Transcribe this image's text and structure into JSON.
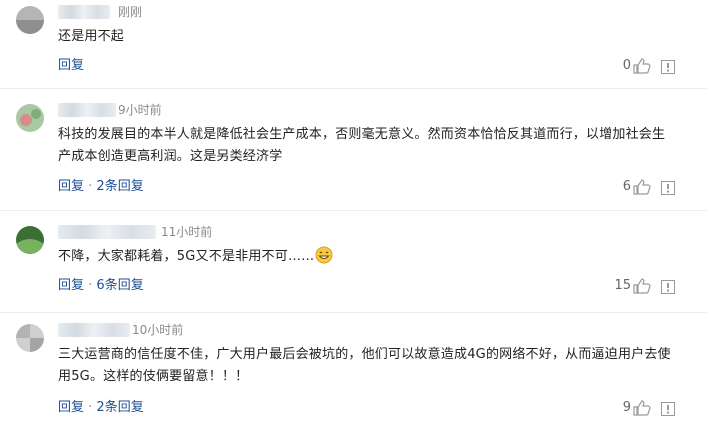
{
  "comments": [
    {
      "time": "刚刚",
      "text": "还是用不起",
      "reply": "回复",
      "more": "",
      "likes": "0",
      "avatar_colors": [
        "#b8b8b8",
        "#909090"
      ]
    },
    {
      "time": "9小时前",
      "text": "科技的发展目的本半人就是降低社会生产成本，否则毫无意义。然而资本恰恰反其道而行，以增加社会生产成本创造更高利润。这是另类经济学",
      "reply": "回复",
      "more": "2条回复",
      "likes": "6",
      "avatar_colors": [
        "#8fb58a",
        "#d18a8a"
      ]
    },
    {
      "time": "11小时前",
      "text": "不降，大家都耗着，5G又不是非用不可……",
      "reply": "回复",
      "more": "6条回复",
      "likes": "15",
      "avatar_colors": [
        "#5f9a4a",
        "#2f5d2a"
      ]
    },
    {
      "time": "10小时前",
      "text": "三大运营商的信任度不佳，广大用户最后会被坑的，他们可以故意造成4G的网络不好，从而逼迫用户去使用5G。这样的伎俩要留意！！！",
      "reply": "回复",
      "more": "2条回复",
      "likes": "9",
      "avatar_colors": [
        "#c9c9c9",
        "#a3a3a3"
      ]
    }
  ],
  "separator": " · ",
  "icons": {
    "like": "thumbs-up-icon",
    "report": "report-icon",
    "emoji": "grinning-emoji-icon"
  },
  "colors": {
    "link": "#1e4f94",
    "muted": "#8a8a8a",
    "text": "#222222"
  }
}
